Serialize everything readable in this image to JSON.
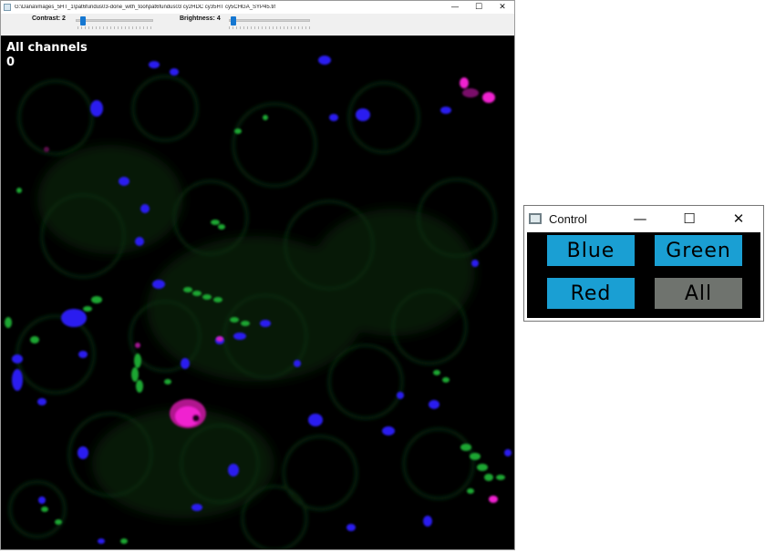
{
  "main_window": {
    "title": "G:\\Dana\\images_5HT_1\\pat6fundus03-done_with_tool\\pat6fundus03 cy2HDC cy35HT cy5CHGA_SYP45.tif",
    "minimize_glyph": "—",
    "maximize_glyph": "☐",
    "close_glyph": "✕"
  },
  "toolbar": {
    "contrast_label": "Contrast: 2",
    "contrast_level": 2,
    "brightness_label": "Brightness: 4",
    "brightness_level": 4
  },
  "image_overlay": {
    "title": "All channels",
    "value": "0"
  },
  "control_window": {
    "title": "Control",
    "minimize_glyph": "—",
    "maximize_glyph": "☐",
    "close_glyph": "✕",
    "buttons": {
      "blue": "Blue",
      "green": "Green",
      "red": "Red",
      "all": "All"
    }
  },
  "colors": {
    "channel_button_active": "#1a9fd3",
    "channel_button_selected": "#6f736e",
    "slider_thumb": "#1577d1",
    "blue_channel": "#2a1ff0",
    "green_channel": "#1ea632",
    "magenta_channel": "#f020d0"
  }
}
